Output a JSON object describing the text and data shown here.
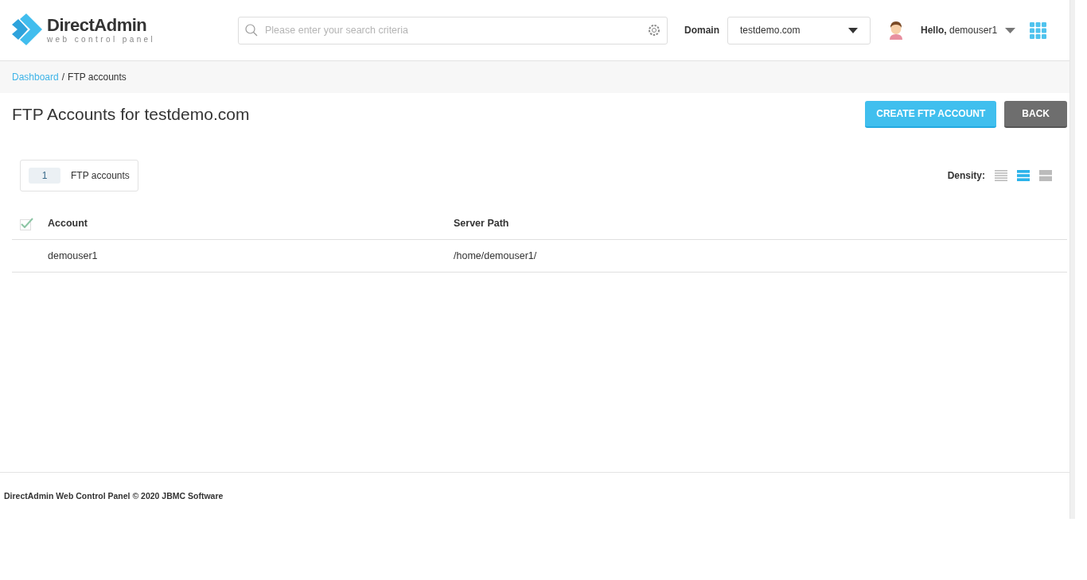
{
  "header": {
    "logo": {
      "name": "DirectAdmin",
      "tagline": "web control panel"
    },
    "search": {
      "placeholder": "Please enter your search criteria"
    },
    "domain": {
      "label": "Domain",
      "value": "testdemo.com"
    },
    "user": {
      "greeting": "Hello,",
      "name": "demouser1"
    }
  },
  "breadcrumb": [
    {
      "label": "Dashboard",
      "kind": "link"
    },
    {
      "label": "FTP accounts",
      "kind": "current"
    }
  ],
  "breadcrumb_separator": "/",
  "page": {
    "title": "FTP Accounts for testdemo.com",
    "buttons": [
      {
        "label": "CREATE FTP ACCOUNT",
        "kind": "primary"
      },
      {
        "label": "BACK",
        "kind": "secondary"
      }
    ]
  },
  "summary": {
    "count": "1",
    "label": "FTP accounts"
  },
  "density": {
    "label": "Density:",
    "options": [
      {
        "kind": "compact",
        "selected": false
      },
      {
        "kind": "normal",
        "selected": true
      },
      {
        "kind": "wide",
        "selected": false
      }
    ]
  },
  "table": {
    "select_all_checked": false,
    "columns": [
      "Account",
      "Server Path"
    ],
    "rows": [
      [
        "demouser1",
        "/home/demouser1/"
      ]
    ]
  },
  "footer": "DirectAdmin Web Control Panel © 2020 JBMC Software"
}
